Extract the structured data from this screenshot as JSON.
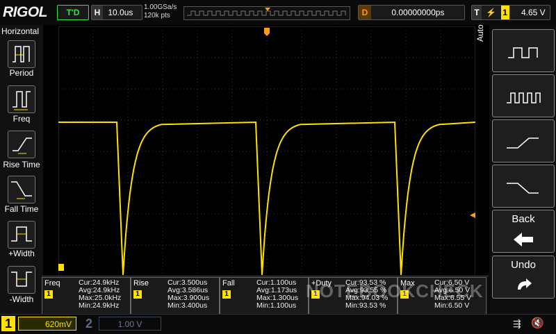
{
  "brand": "RIGOL",
  "trigger_status": "T'D",
  "horizontal": {
    "label": "H",
    "value": "10.0us"
  },
  "sample": {
    "rate": "1.00GSa/s",
    "points": "120k pts"
  },
  "delay": {
    "label": "D",
    "value": "0.00000000ps"
  },
  "trigger": {
    "label": "T",
    "source": "1",
    "level": "4.65 V"
  },
  "left_menu": {
    "title": "Horizontal",
    "items": [
      {
        "label": "Period"
      },
      {
        "label": "Freq"
      },
      {
        "label": "Rise Time"
      },
      {
        "label": "Fall Time"
      },
      {
        "label": "+Width"
      },
      {
        "label": "-Width"
      }
    ]
  },
  "right_menu": {
    "mode_label": "Auto",
    "back_label": "Back",
    "undo_label": "Undo"
  },
  "measurements": [
    {
      "name": "Freq",
      "cur": "Cur:24.9kHz",
      "avg": "Avg:24.9kHz",
      "max": "Max:25.0kHz",
      "min": "Min:24.9kHz"
    },
    {
      "name": "Rise",
      "cur": "Cur:3.500us",
      "avg": "Avg:3.586us",
      "max": "Max:3.900us",
      "min": "Min:3.400us"
    },
    {
      "name": "Fall",
      "cur": "Cur:1.100us",
      "avg": "Avg:1.173us",
      "max": "Max:1.300us",
      "min": "Min:1.100us"
    },
    {
      "name": "+Duty",
      "cur": "Cur:93.53 %",
      "avg": "Avg:93.55 %",
      "max": "Max:94.03 %",
      "min": "Min:93.53 %"
    },
    {
      "name": "Max",
      "cur": "Cur:6.50 V",
      "avg": "Avg:6.50 V",
      "max": "Max:6.55 V",
      "min": "Min:6.50 V"
    }
  ],
  "channels": [
    {
      "id": "1",
      "scale": "620mV"
    },
    {
      "id": "2",
      "scale": "1.00 V"
    }
  ],
  "watermark": "NOTEBOOKCHECK",
  "colors": {
    "ch1": "#ffe100",
    "trigger": "#ff9a1a",
    "grid": "#3a3a3a"
  }
}
